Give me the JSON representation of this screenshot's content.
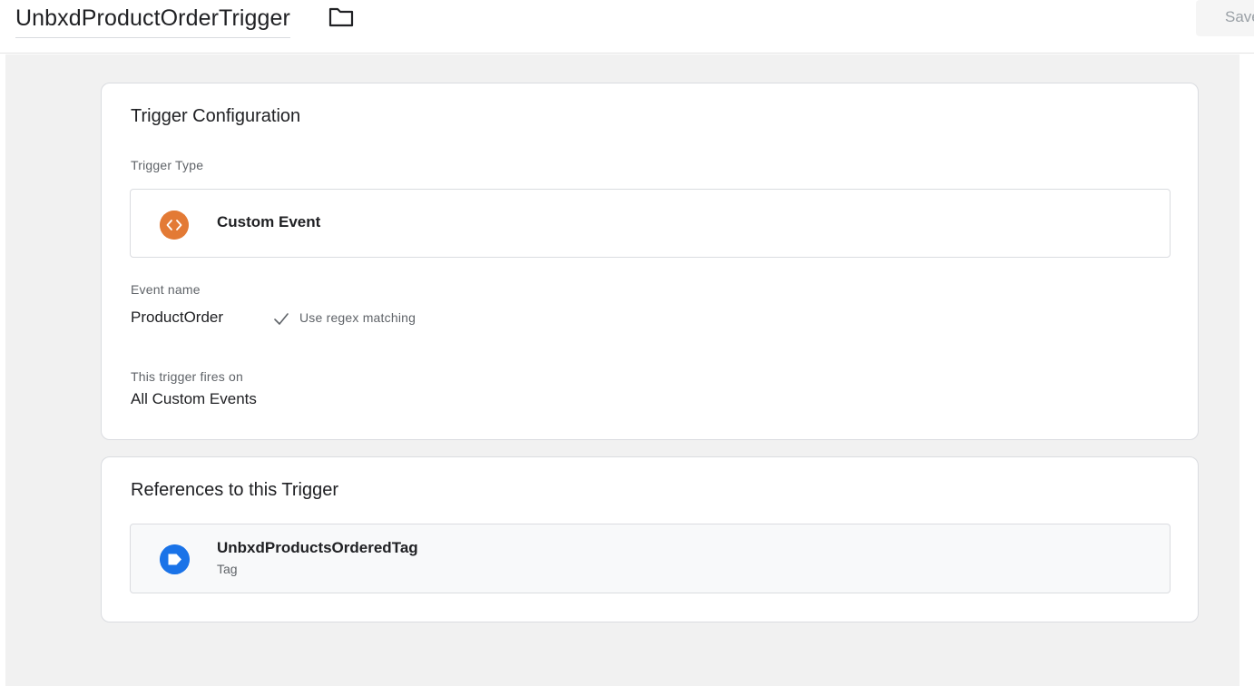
{
  "header": {
    "trigger_name": "UnbxdProductOrderTrigger",
    "folder_icon": "folder-icon",
    "save_label": "Save"
  },
  "trigger_config": {
    "title": "Trigger Configuration",
    "type_label": "Trigger Type",
    "type_value": "Custom Event",
    "type_icon": "code-brackets-icon",
    "type_icon_color": "#e37a35",
    "event_name_label": "Event name",
    "event_name_value": "ProductOrder",
    "regex_icon": "checkmark-icon",
    "regex_label": "Use regex matching",
    "fires_on_label": "This trigger fires on",
    "fires_on_value": "All Custom Events"
  },
  "references": {
    "title": "References to this Trigger",
    "items": [
      {
        "name": "UnbxdProductsOrderedTag",
        "type": "Tag",
        "icon": "tag-icon",
        "icon_color": "#1a73e8"
      }
    ]
  }
}
